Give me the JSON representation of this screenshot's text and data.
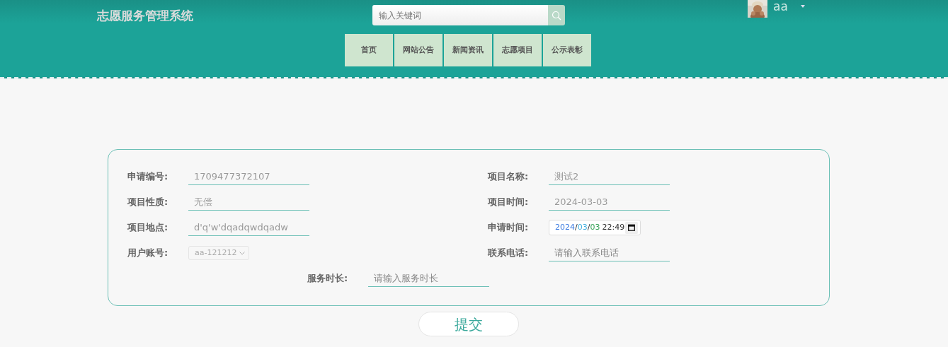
{
  "header": {
    "title": "志愿服务管理系统",
    "search": {
      "placeholder": "输入关键词"
    },
    "user": {
      "name": "aa"
    }
  },
  "nav": [
    {
      "label": "首页"
    },
    {
      "label": "网站公告"
    },
    {
      "label": "新闻资讯"
    },
    {
      "label": "志愿项目"
    },
    {
      "label": "公示表彰"
    }
  ],
  "form": {
    "fields": [
      {
        "kind": "text",
        "label": "申请编号:",
        "value": "1709477372107"
      },
      {
        "kind": "text",
        "label": "项目名称:",
        "value": "测试2"
      },
      {
        "kind": "text",
        "label": "项目性质:",
        "value": "无偿"
      },
      {
        "kind": "text",
        "label": "项目时间:",
        "value": "2024-03-03"
      },
      {
        "kind": "text",
        "label": "项目地点:",
        "value": "d'q'w'dqadqwdqadw"
      },
      {
        "kind": "date",
        "label": "申请时间:",
        "parts": [
          {
            "text": "2024",
            "color": "#3b7be0"
          },
          {
            "text": "/"
          },
          {
            "text": "03",
            "color": "#44b0e0"
          },
          {
            "text": "/"
          },
          {
            "text": "03",
            "color": "#3aa35a"
          }
        ],
        "time": "22:49"
      },
      {
        "kind": "select",
        "label": "用户账号:",
        "value": "aa-121212"
      },
      {
        "kind": "text",
        "label": "联系电话:",
        "placeholder": "请输入联系电话"
      },
      {
        "kind": "text",
        "label": "服务时长:",
        "placeholder": "请输入服务时长"
      }
    ],
    "submit": "提交"
  }
}
